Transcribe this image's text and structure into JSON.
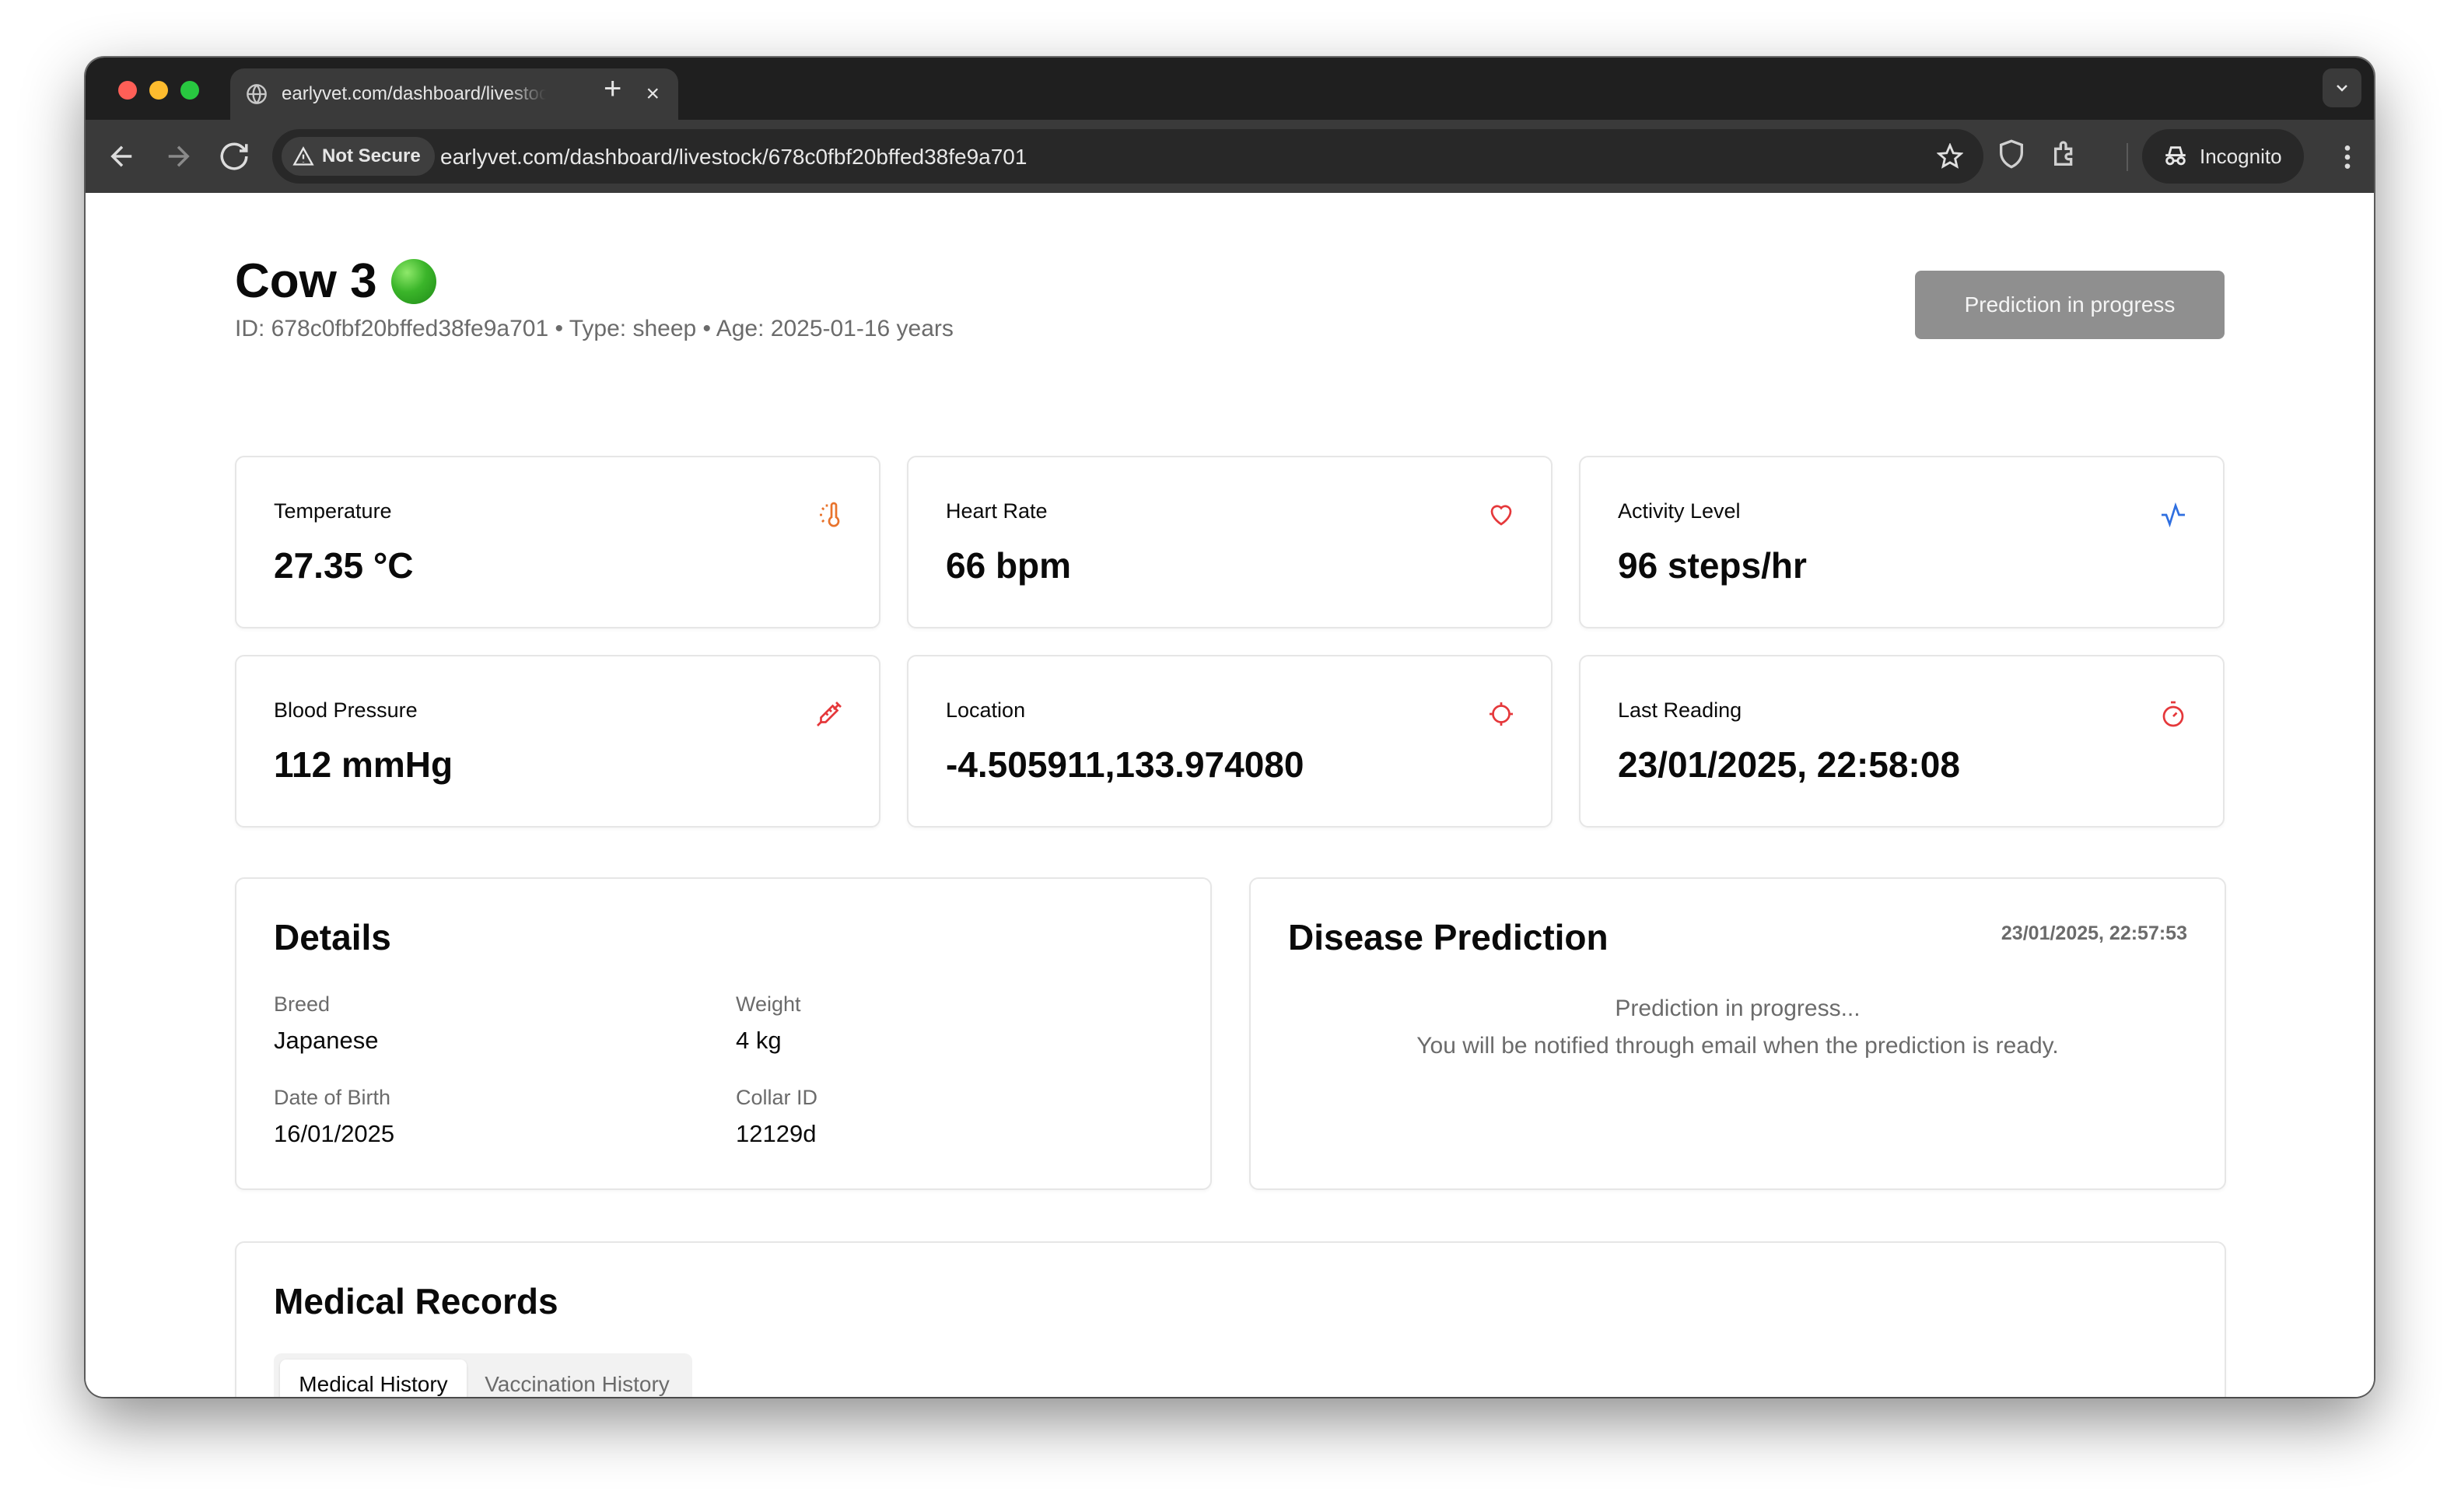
{
  "browser": {
    "tab_title": "earlyvet.com/dashboard/livestock/678c0fbf20bffed38fe9a701",
    "security_label": "Not Secure",
    "url": "earlyvet.com/dashboard/livestock/678c0fbf20bffed38fe9a701",
    "profile_label": "Incognito"
  },
  "header": {
    "title": "Cow 3",
    "status_color": "#2fa61f",
    "subtitle": "ID: 678c0fbf20bffed38fe9a701 • Type: sheep • Age: 2025-01-16 years",
    "action_button": "Prediction in progress"
  },
  "metrics": [
    {
      "label": "Temperature",
      "value": "27.35 °C",
      "icon": "thermometer-sun-icon",
      "color": "#e8732c"
    },
    {
      "label": "Heart Rate",
      "value": "66 bpm",
      "icon": "heart-icon",
      "color": "#e5383b"
    },
    {
      "label": "Activity Level",
      "value": "96 steps/hr",
      "icon": "activity-icon",
      "color": "#2f6fe0"
    },
    {
      "label": "Blood Pressure",
      "value": "112 mmHg",
      "icon": "syringe-icon",
      "color": "#e5383b"
    },
    {
      "label": "Location",
      "value": "-4.505911,133.974080",
      "icon": "locate-icon",
      "color": "#e5383b"
    },
    {
      "label": "Last Reading",
      "value": "23/01/2025, 22:58:08",
      "icon": "timer-icon",
      "color": "#e5383b"
    }
  ],
  "details": {
    "title": "Details",
    "breed_label": "Breed",
    "breed": "Japanese",
    "weight_label": "Weight",
    "weight": "4 kg",
    "dob_label": "Date of Birth",
    "dob": "16/01/2025",
    "collar_label": "Collar ID",
    "collar": "12129d"
  },
  "prediction": {
    "title": "Disease Prediction",
    "timestamp": "23/01/2025, 22:57:53",
    "status": "Prediction in progress...",
    "note": "You will be notified through email when the prediction is ready."
  },
  "records": {
    "title": "Medical Records",
    "tabs": [
      "Medical History",
      "Vaccination History"
    ],
    "active_tab": "Medical History"
  }
}
